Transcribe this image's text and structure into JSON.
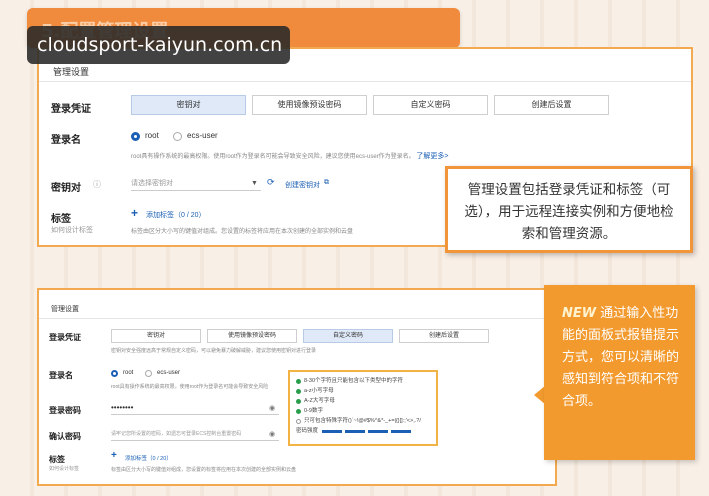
{
  "header": {
    "title": "5.配置管理设置"
  },
  "watermark": "cloudsport-kaiyun.com.cn",
  "panel1": {
    "section_title": "管理设置",
    "login_cred_label": "登录凭证",
    "cred_options": [
      "密钥对",
      "使用镜像预设密码",
      "自定义密码",
      "创建后设置"
    ],
    "login_name_label": "登录名",
    "login_names": [
      "root",
      "ecs-user"
    ],
    "login_desc": "root具有操作系统的最高权限。使用root作为登录名可能会导致安全风险，建议您使用ecs-user作为登录名。",
    "learn_more": "了解更多>",
    "keypair_label": "密钥对",
    "keypair_placeholder": "请选择密钥对",
    "create_keypair": "创建密钥对",
    "tag_label": "标签",
    "tag_sub": "如何设计标签",
    "add_tag": "添加标签（0 / 20）",
    "tag_desc": "标签由区分大小写的键值对组成。您设置的标签将应用在本次创建的全部实例和云盘"
  },
  "callout1": {
    "text": "管理设置包括登录凭证和标签（可选），用于远程连接实例和方便地检索和管理资源。"
  },
  "panel2": {
    "section_title": "管理设置",
    "login_cred_label": "登录凭证",
    "cred_options": [
      "密钥对",
      "使用镜像预设密码",
      "自定义密码",
      "创建后设置"
    ],
    "cred_desc": "密钥对安全强度远高于常规自定义密码，可以避免暴力破解威胁，建议您使用密钥对进行登录",
    "login_name_label": "登录名",
    "login_names": [
      "root",
      "ecs-user"
    ],
    "login_desc": "root具有操作系统的最高权限，使用root作为登录名可能会导致安全风险",
    "password_label": "登录密码",
    "password_value": "••••••••",
    "confirm_label": "确认密码",
    "confirm_placeholder": "请牢记您所设置的密码，如遗忘可登录ECS控制台重置密码",
    "tag_label": "标签",
    "tag_sub": "如何设计标签",
    "add_tag": "添加标签（0 / 20）",
    "tag_desc": "标签由区分大小写的键值对组成，您设置的标签将应用在本次创建的全部实例和云盘",
    "tips": [
      "8-30个字符且只能包含以下类型中的字符",
      "a-z小写字母",
      "A-Z大写字母",
      "0-9数字",
      "只可包含特殊字符()`~!@#$%^&*-_+=|{}[]:;'<>,.?/"
    ],
    "strength_label": "密码强度"
  },
  "callout2": {
    "new_label": "NEW",
    "text": "通过输入性功能的面板式报错提示方式，您可以清晰的感知到符合项和不符合项。"
  },
  "colors": {
    "accent": "#f08a3c",
    "link": "#1a5fb4",
    "callout_border": "#f0953a"
  }
}
